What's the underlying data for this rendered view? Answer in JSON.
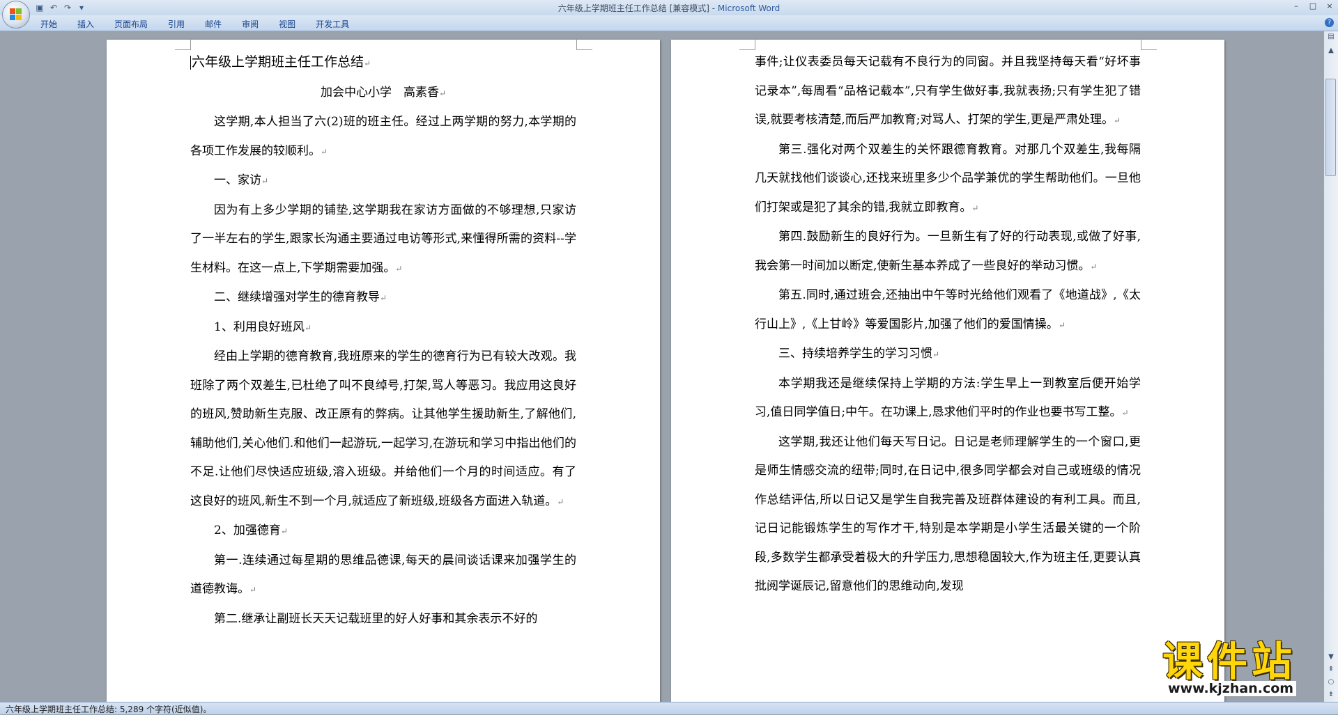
{
  "window": {
    "title_doc": "六年级上学期班主任工作总结 [兼容模式] - ",
    "title_app": "Microsoft Word",
    "controls": [
      "–",
      "□",
      "×"
    ]
  },
  "quick_access": {
    "icons": [
      "save-icon",
      "undo-icon",
      "redo-icon",
      "customize-icon"
    ]
  },
  "ribbon": {
    "tabs": [
      "开始",
      "插入",
      "页面布局",
      "引用",
      "邮件",
      "审阅",
      "视图",
      "开发工具"
    ],
    "help": "?"
  },
  "document": {
    "page1": [
      {
        "style": "title",
        "text": "六年级上学期班主任工作总结"
      },
      {
        "style": "center",
        "text": "加会中心小学　高素香"
      },
      {
        "style": "indent",
        "text": "这学期,本人担当了六(2)班的班主任。经过上两学期的努力,本学期的各项工作发展的较顺利。"
      },
      {
        "style": "indent",
        "text": "一、家访"
      },
      {
        "style": "indent",
        "text": "因为有上多少学期的铺垫,这学期我在家访方面做的不够理想,只家访了一半左右的学生,跟家长沟通主要通过电访等形式,来懂得所需的资料--学生材料。在这一点上,下学期需要加强。"
      },
      {
        "style": "indent",
        "text": "二、继续增强对学生的德育教导"
      },
      {
        "style": "indent",
        "text": "1、利用良好班风"
      },
      {
        "style": "indent",
        "text": "经由上学期的德育教育,我班原来的学生的德育行为已有较大改观。我班除了两个双差生,已杜绝了叫不良绰号,打架,骂人等恶习。我应用这良好的班风,赞助新生克服、改正原有的弊病。让其他学生援助新生,了解他们,辅助他们,关心他们.和他们一起游玩,一起学习,在游玩和学习中指出他们的不足.让他们尽快适应班级,溶入班级。并给他们一个月的时间适应。有了这良好的班风,新生不到一个月,就适应了新班级,班级各方面进入轨道。"
      },
      {
        "style": "indent",
        "text": "2、加强德育"
      },
      {
        "style": "indent",
        "text": "第一.连续通过每星期的思维品德课,每天的晨间谈话课来加强学生的道德教诲。"
      },
      {
        "style": "indent",
        "text": "第二.继承让副班长天天记载班里的好人好事和其余表示不好的",
        "nomark": true
      }
    ],
    "page2": [
      {
        "style": "plain",
        "text": "事件;让仪表委员每天记载有不良行为的同窗。并且我坚持每天看“好坏事记录本”,每周看“品格记载本”,只有学生做好事,我就表扬;只有学生犯了错误,就要考核清楚,而后严加教育;对骂人、打架的学生,更是严肃处理。"
      },
      {
        "style": "indent",
        "text": "第三.强化对两个双差生的关怀跟德育教育。对那几个双差生,我每隔几天就找他们谈谈心,还找来班里多少个品学兼优的学生帮助他们。一旦他们打架或是犯了其余的错,我就立即教育。"
      },
      {
        "style": "indent",
        "text": "第四.鼓励新生的良好行为。一旦新生有了好的行动表现,或做了好事,我会第一时间加以断定,使新生基本养成了一些良好的举动习惯。"
      },
      {
        "style": "indent",
        "text": "第五.同时,通过班会,还抽出中午等时光给他们观看了《地道战》,《太行山上》,《上甘岭》等爱国影片,加强了他们的爱国情操。"
      },
      {
        "style": "indent",
        "text": "三、持续培养学生的学习习惯"
      },
      {
        "style": "indent",
        "text": "本学期我还是继续保持上学期的方法:学生早上一到教室后便开始学习,值日同学值日;中午。在功课上,恳求他们平时的作业也要书写工整。"
      },
      {
        "style": "indent",
        "text": "这学期,我还让他们每天写日记。日记是老师理解学生的一个窗口,更是师生情感交流的纽带;同时,在日记中,很多同学都会对自己或班级的情况作总结评估,所以日记又是学生自我完善及班群体建设的有利工具。而且,记日记能锻炼学生的写作才干,特别是本学期是小学生活最关键的一个阶段,多数学生都承受着极大的升学压力,思想稳固较大,作为班主任,更要认真批阅学诞辰记,留意他们的思维动向,发现",
        "nomark": true
      }
    ],
    "paragraph_mark": "↵"
  },
  "statusbar": {
    "text": "六年级上学期班主任工作总结: 5,289 个字符(近似值)。"
  },
  "watermark": {
    "main": "课件站",
    "url": "www.kjzhan.com"
  }
}
